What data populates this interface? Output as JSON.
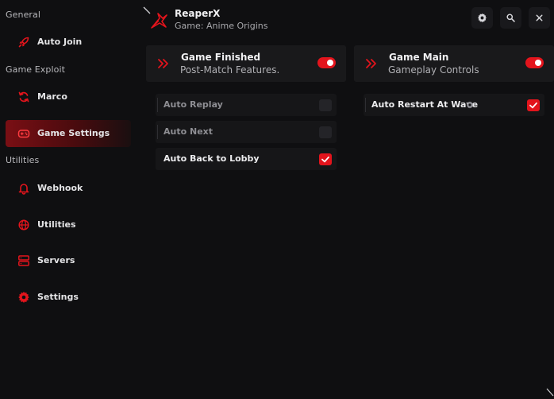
{
  "app": {
    "title": "ReaperX",
    "subtitle": "Game: Anime Origins",
    "accent": "#e3141c"
  },
  "sidebar": {
    "sections": [
      {
        "label": "General"
      },
      {
        "label": "Game Exploit"
      },
      {
        "label": "Utilities"
      }
    ],
    "items": [
      {
        "label": "Auto Join",
        "icon": "rocket-icon"
      },
      {
        "label": "Marco",
        "icon": "refresh-icon"
      },
      {
        "label": "Game Settings",
        "icon": "gamepad-icon",
        "active": true
      },
      {
        "label": "Webhook",
        "icon": "bell-icon"
      },
      {
        "label": "Utilities",
        "icon": "globe-icon"
      },
      {
        "label": "Servers",
        "icon": "server-icon"
      },
      {
        "label": "Settings",
        "icon": "gear-icon"
      }
    ]
  },
  "header_buttons": [
    {
      "icon": "gear-icon"
    },
    {
      "icon": "search-icon"
    },
    {
      "icon": "close-icon"
    }
  ],
  "panels": {
    "left": {
      "title": "Game Finished",
      "subtitle": "Post-Match Features.",
      "enabled": true,
      "options": [
        {
          "label": "Auto Replay",
          "checked": false
        },
        {
          "label": "Auto Next",
          "checked": false
        },
        {
          "label": "Auto Back to Lobby",
          "checked": true
        }
      ]
    },
    "right": {
      "title": "Game Main",
      "subtitle": "Gameplay Controls",
      "enabled": true,
      "options": [
        {
          "label": "Auto Restart At Wave",
          "checked": true,
          "has_settings": true
        }
      ]
    }
  }
}
